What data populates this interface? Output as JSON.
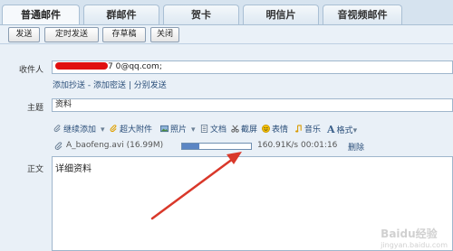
{
  "tabs": [
    {
      "label": "普通邮件"
    },
    {
      "label": "群邮件"
    },
    {
      "label": "贺卡"
    },
    {
      "label": "明信片"
    },
    {
      "label": "音视频邮件"
    }
  ],
  "toolbar": {
    "send_label": "发送",
    "scheduled_label": "定时发送",
    "draft_label": "存草稿",
    "close_label": "关闭"
  },
  "form": {
    "to_label": "收件人",
    "to_value": "7 0@qq.com;",
    "cc_links": [
      "添加抄送",
      "添加密送",
      "分别发送"
    ],
    "subject_label": "主题",
    "subject_value": "资料",
    "body_label": "正文",
    "body_value": "详细资料"
  },
  "format_bar": {
    "continue_add": "继续添加",
    "big_attachment": "超大附件",
    "photo": "照片",
    "document": "文档",
    "screenshot": "截屏",
    "emoji": "表情",
    "music": "音乐",
    "format": "格式"
  },
  "attachment": {
    "file_name": "A_baofeng.avi (16.99M)",
    "progress": 0.25,
    "speed_text": "160.91K/s 00:01:16",
    "delete_label": "删除"
  },
  "watermark": {
    "main": "Baidu经验",
    "sub": "jingyan.baidu.com"
  },
  "colors": {
    "arrow": "#d9382a",
    "progress": "#5b86c4",
    "redaction": "#e01010"
  }
}
